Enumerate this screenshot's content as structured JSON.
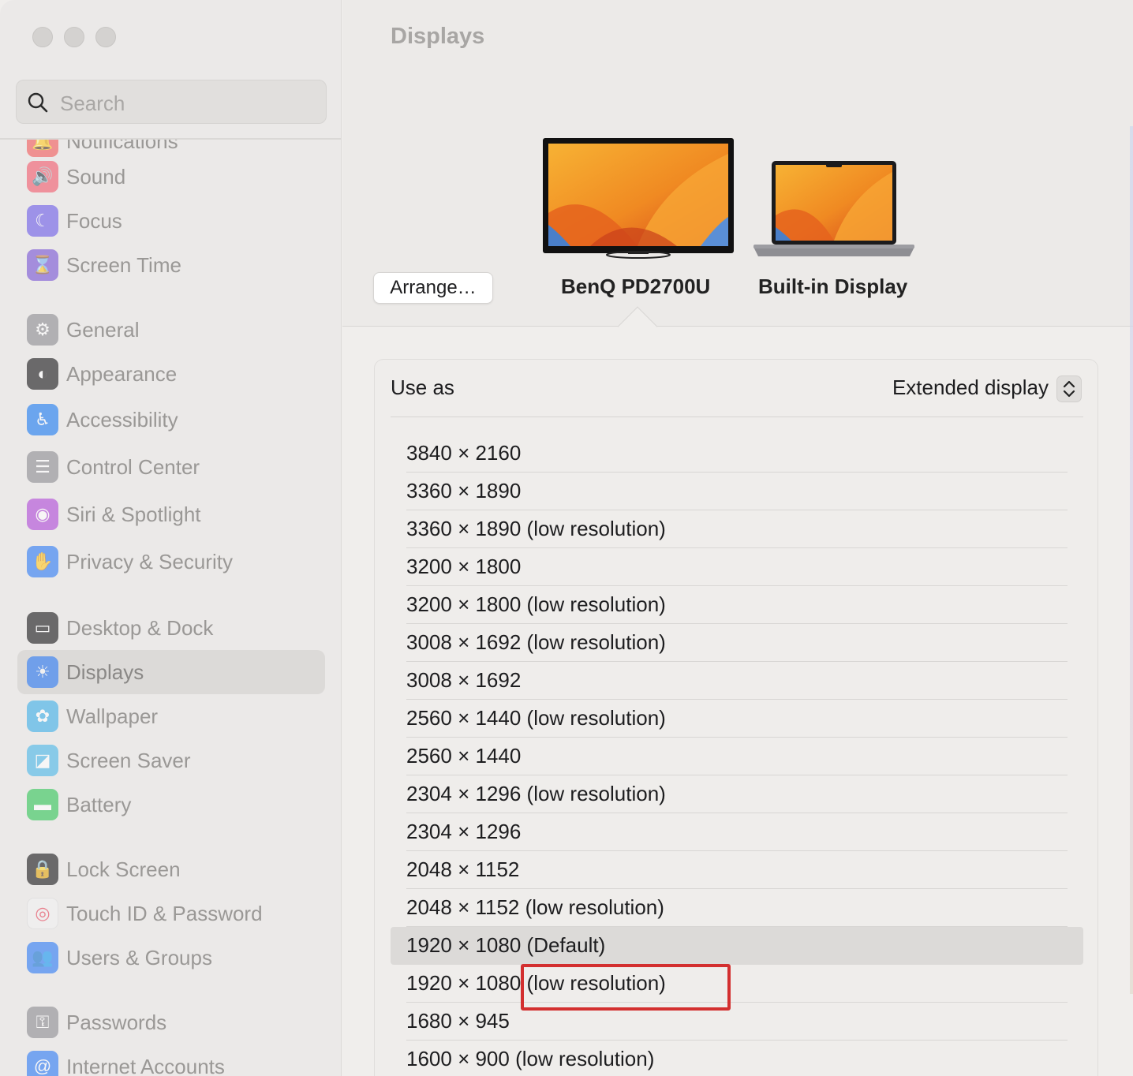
{
  "window": {
    "title": "Displays"
  },
  "search": {
    "placeholder": "Search",
    "icon": "search-icon"
  },
  "sidebar": {
    "items": [
      {
        "label": "Notifications",
        "icon": "bell-icon",
        "color": "#f25c5c"
      },
      {
        "label": "Sound",
        "icon": "speaker-icon",
        "color": "#f25c6e"
      },
      {
        "label": "Focus",
        "icon": "moon-icon",
        "color": "#6e5ee8"
      },
      {
        "label": "Screen Time",
        "icon": "hourglass-icon",
        "color": "#7a55d6"
      },
      {
        "label": "General",
        "icon": "gear-icon",
        "color": "#8e8e93"
      },
      {
        "label": "Appearance",
        "icon": "appearance-icon",
        "color": "#1c1c1e"
      },
      {
        "label": "Accessibility",
        "icon": "accessibility-icon",
        "color": "#1e7cf2"
      },
      {
        "label": "Control Center",
        "icon": "toggles-icon",
        "color": "#8e8e93"
      },
      {
        "label": "Siri & Spotlight",
        "icon": "siri-icon",
        "color": "#b14bd8"
      },
      {
        "label": "Privacy & Security",
        "icon": "hand-icon",
        "color": "#2f7cf6"
      },
      {
        "label": "Desktop & Dock",
        "icon": "dock-icon",
        "color": "#1c1c1e"
      },
      {
        "label": "Displays",
        "icon": "sun-icon",
        "color": "#2f7cf6"
      },
      {
        "label": "Wallpaper",
        "icon": "flower-icon",
        "color": "#3fb0e8"
      },
      {
        "label": "Screen Saver",
        "icon": "screensaver-icon",
        "color": "#4cb8e8"
      },
      {
        "label": "Battery",
        "icon": "battery-icon",
        "color": "#34c759"
      },
      {
        "label": "Lock Screen",
        "icon": "lock-icon",
        "color": "#1c1c1e"
      },
      {
        "label": "Touch ID & Password",
        "icon": "fingerprint-icon",
        "color": "#f2f2f2"
      },
      {
        "label": "Users & Groups",
        "icon": "users-icon",
        "color": "#2f7cf6"
      },
      {
        "label": "Passwords",
        "icon": "key-icon",
        "color": "#8e8e93"
      },
      {
        "label": "Internet Accounts",
        "icon": "at-icon",
        "color": "#2f7cf6"
      }
    ],
    "selected": "Displays"
  },
  "header": {
    "arrange_label": "Arrange…",
    "displays": [
      {
        "name": "BenQ PD2700U",
        "icon": "external-monitor-icon",
        "selected": true
      },
      {
        "name": "Built-in Display",
        "icon": "laptop-icon",
        "selected": false
      }
    ]
  },
  "settings": {
    "use_as_label": "Use as",
    "use_as_value": "Extended display",
    "resolutions": [
      "3840 × 2160",
      "3360 × 1890",
      "3360 × 1890 (low resolution)",
      "3200 × 1800",
      "3200 × 1800 (low resolution)",
      "3008 × 1692 (low resolution)",
      "3008 × 1692",
      "2560 × 1440 (low resolution)",
      "2560 × 1440",
      "2304 × 1296 (low resolution)",
      "2304 × 1296",
      "2048 × 1152",
      "2048 × 1152 (low resolution)",
      "1920 × 1080 (Default)",
      "1920 × 1080 (low resolution)",
      "1680 × 945",
      "1600 × 900 (low resolution)"
    ],
    "selected_resolution": "1920 × 1080 (Default)"
  },
  "annotation": {
    "highlight_color": "#d32f2f",
    "highlighted_text": "(low resolution)"
  }
}
